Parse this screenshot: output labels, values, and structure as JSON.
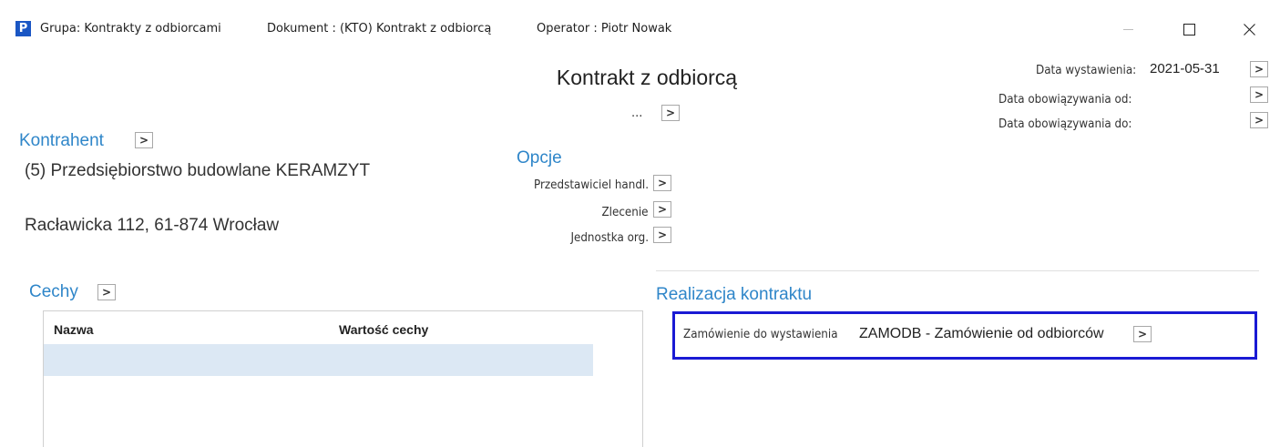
{
  "titlebar": {
    "logo": "P",
    "group": "Grupa: Kontrakty z odbiorcami",
    "document": "Dokument : (KTO) Kontrakt z odbiorcą",
    "operator": "Operator : Piotr Nowak",
    "minimize_icon": "minimize-icon",
    "maximize_icon": "maximize-icon",
    "close_icon": "close-icon"
  },
  "header": {
    "title": "Kontrakt z odbiorcą",
    "ellipsis": "...",
    "arrow_glyph": ">"
  },
  "dates": {
    "issue_label": "Data wystawienia:",
    "issue_value": "2021-05-31",
    "valid_from_label": "Data obowiązywania od:",
    "valid_to_label": "Data obowiązywania do:"
  },
  "contractor": {
    "title": "Kontrahent",
    "name": "(5) Przedsiębiorstwo budowlane KERAMZYT",
    "address": "Racławicka 112, 61-874 Wrocław"
  },
  "options": {
    "title": "Opcje",
    "sales_rep": "Przedstawiciel handl.",
    "order": "Zlecenie",
    "org_unit": "Jednostka org."
  },
  "features": {
    "title": "Cechy",
    "columns": [
      "Nazwa",
      "Wartość cechy"
    ]
  },
  "realization": {
    "title": "Realizacja kontraktu",
    "order_label": "Zamówienie do wystawienia",
    "order_value": "ZAMODB - Zamówienie od odbiorców"
  }
}
